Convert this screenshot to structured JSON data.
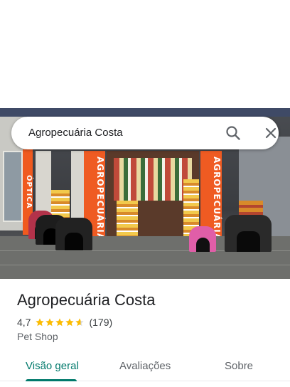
{
  "search": {
    "query": "Agropecuária Costa"
  },
  "hero": {
    "sign_left": "ÓPTICA",
    "sign_center": "AGROPECUÁRIA",
    "sign_right": "AGROPECUÁRIA"
  },
  "place": {
    "title": "Agropecuária Costa",
    "rating": "4,7",
    "stars": 4.7,
    "reviews": "(179)",
    "category": "Pet Shop"
  },
  "tabs": [
    {
      "label": "Visão geral",
      "active": true
    },
    {
      "label": "Avaliações",
      "active": false
    },
    {
      "label": "Sobre",
      "active": false
    }
  ],
  "colors": {
    "accent": "#00796b",
    "star": "#fbbc04",
    "sign": "#ef5b22"
  },
  "icons": {
    "search": "search-icon",
    "close": "close-icon"
  }
}
